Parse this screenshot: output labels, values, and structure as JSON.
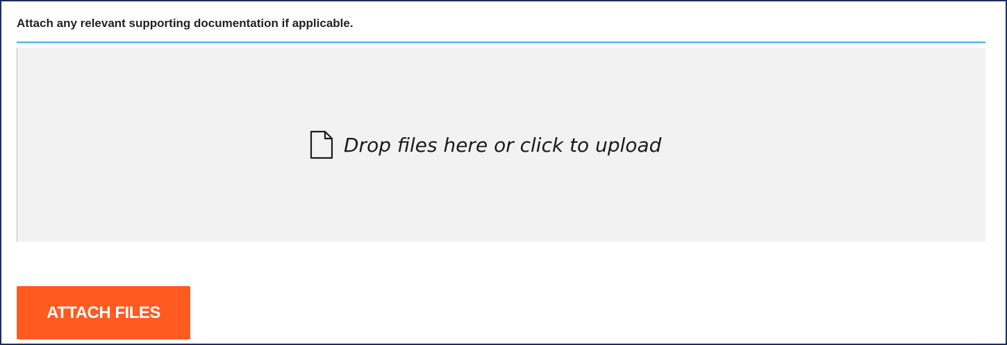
{
  "form": {
    "instruction": "Attach any relevant supporting documentation if applicable."
  },
  "dropzone": {
    "icon": "file-icon",
    "message": "Drop files here or click to upload"
  },
  "actions": {
    "attach_label": "ATTACH FILES"
  },
  "colors": {
    "frame_border": "#1d2d5a",
    "divider": "#35b5e5",
    "dropzone_bg": "#f2f2f2",
    "button_bg": "#ff5a1f",
    "button_text": "#ffffff"
  }
}
